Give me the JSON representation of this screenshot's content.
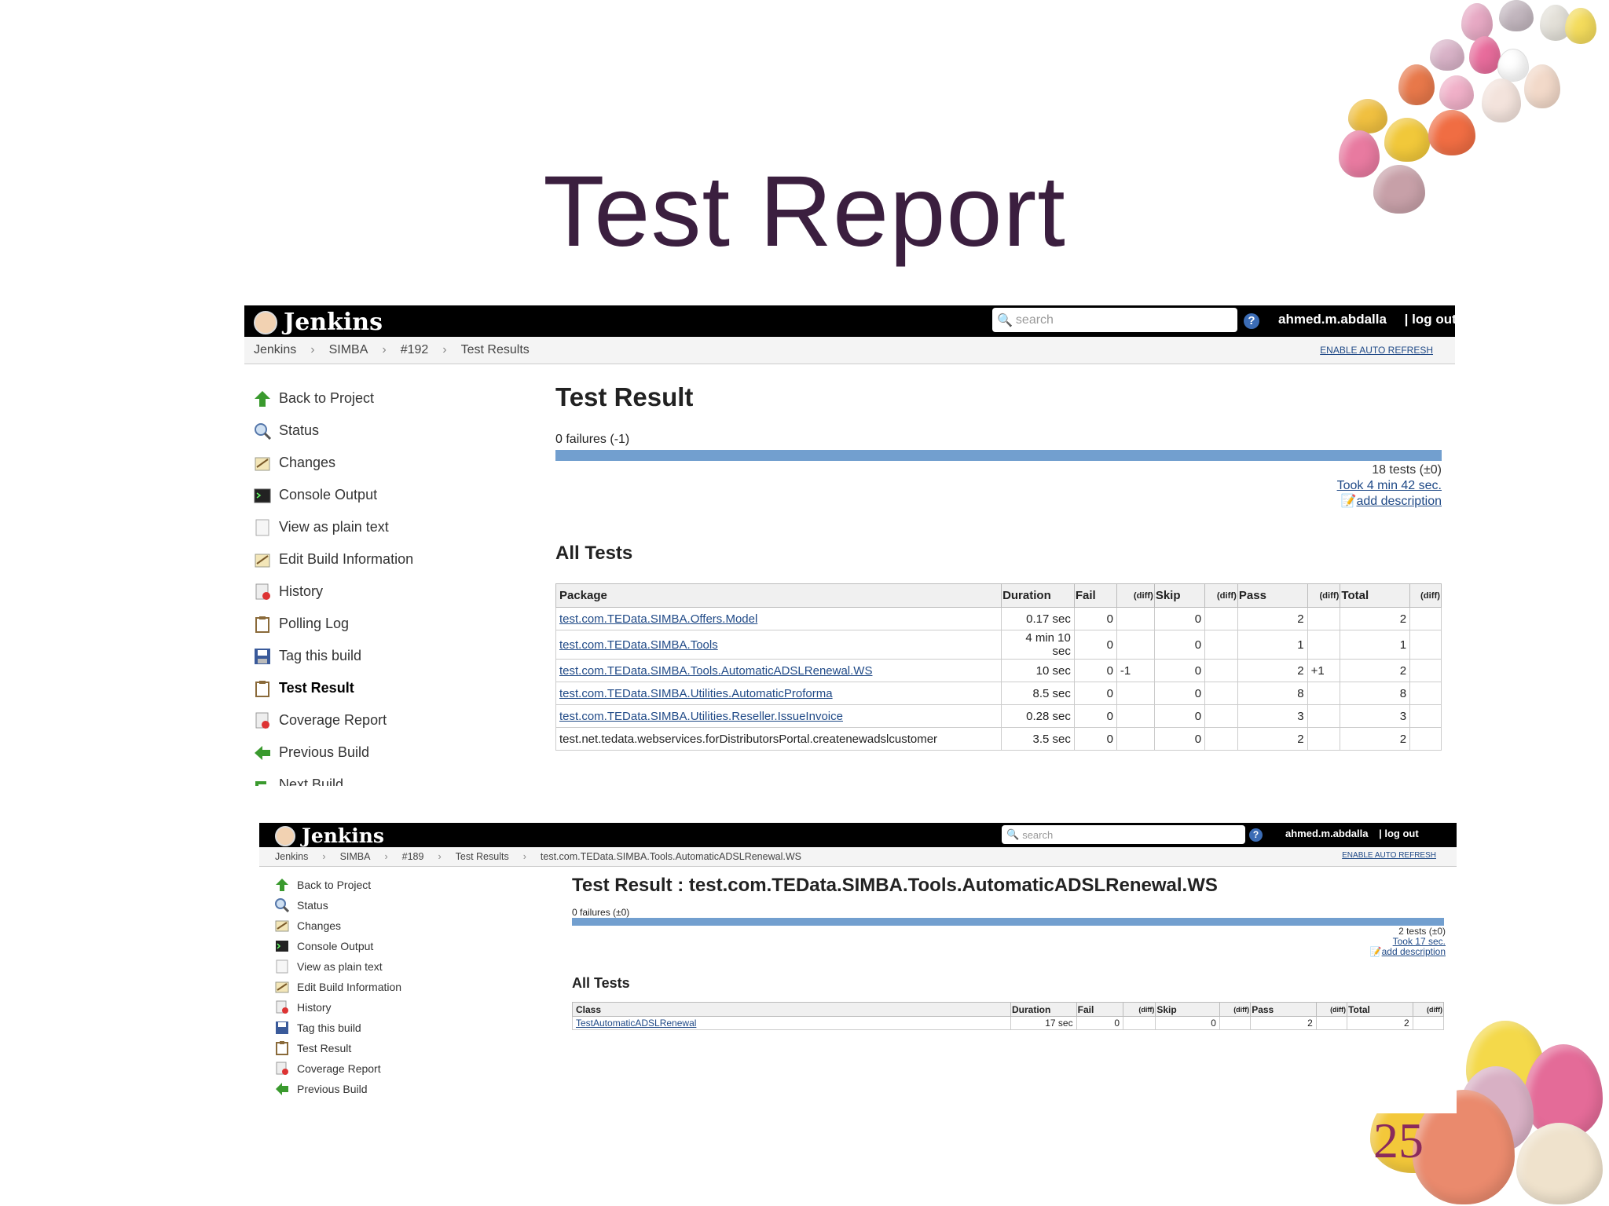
{
  "slide": {
    "title": "Test Report",
    "page_number": "25"
  },
  "panel1": {
    "brand": "Jenkins",
    "search_placeholder": "search",
    "help": "?",
    "user": "ahmed.m.abdalla",
    "logout": "| log out",
    "breadcrumbs": [
      "Jenkins",
      "SIMBA",
      "#192",
      "Test Results"
    ],
    "auto_refresh": "ENABLE AUTO REFRESH",
    "sidebar": [
      {
        "label": "Back to Project",
        "icon": "up-arrow-icon"
      },
      {
        "label": "Status",
        "icon": "magnifier-icon"
      },
      {
        "label": "Changes",
        "icon": "notepad-icon"
      },
      {
        "label": "Console Output",
        "icon": "terminal-icon"
      },
      {
        "label": "View as plain text",
        "icon": "document-icon"
      },
      {
        "label": "Edit Build Information",
        "icon": "notepad-icon"
      },
      {
        "label": "History",
        "icon": "history-icon"
      },
      {
        "label": "Polling Log",
        "icon": "clipboard-icon"
      },
      {
        "label": "Tag this build",
        "icon": "save-icon"
      },
      {
        "label": "Test Result",
        "icon": "clipboard-icon"
      },
      {
        "label": "Coverage Report",
        "icon": "report-icon"
      },
      {
        "label": "Previous Build",
        "icon": "left-arrow-icon"
      },
      {
        "label": "Next Build",
        "icon": "next-arrow-icon"
      }
    ],
    "heading": "Test Result",
    "failures": "0 failures (-1)",
    "progress_pass_fraction": 1.0,
    "tests_summary": "18 tests (±0)",
    "took": "Took 4 min 42 sec.",
    "add_description": "add description",
    "all_tests": "All Tests",
    "columns": [
      "Package",
      "Duration",
      "Fail",
      "(diff)",
      "Skip",
      "(diff)",
      "Pass",
      "(diff)",
      "Total",
      "(diff)"
    ],
    "rows": [
      {
        "name": "test.com.TEData.SIMBA.Offers.Model",
        "link": true,
        "duration": "0.17 sec",
        "fail": "0",
        "fail_diff": "",
        "skip": "0",
        "skip_diff": "",
        "pass": "2",
        "pass_diff": "",
        "total": "2",
        "total_diff": ""
      },
      {
        "name": "test.com.TEData.SIMBA.Tools",
        "link": true,
        "duration": "4 min 10 sec",
        "fail": "0",
        "fail_diff": "",
        "skip": "0",
        "skip_diff": "",
        "pass": "1",
        "pass_diff": "",
        "total": "1",
        "total_diff": ""
      },
      {
        "name": "test.com.TEData.SIMBA.Tools.AutomaticADSLRenewal.WS",
        "link": true,
        "duration": "10 sec",
        "fail": "0",
        "fail_diff": "-1",
        "skip": "0",
        "skip_diff": "",
        "pass": "2",
        "pass_diff": "+1",
        "total": "2",
        "total_diff": ""
      },
      {
        "name": "test.com.TEData.SIMBA.Utilities.AutomaticProforma",
        "link": true,
        "duration": "8.5 sec",
        "fail": "0",
        "fail_diff": "",
        "skip": "0",
        "skip_diff": "",
        "pass": "8",
        "pass_diff": "",
        "total": "8",
        "total_diff": ""
      },
      {
        "name": "test.com.TEData.SIMBA.Utilities.Reseller.IssueInvoice",
        "link": true,
        "duration": "0.28 sec",
        "fail": "0",
        "fail_diff": "",
        "skip": "0",
        "skip_diff": "",
        "pass": "3",
        "pass_diff": "",
        "total": "3",
        "total_diff": ""
      },
      {
        "name": "test.net.tedata.webservices.forDistributorsPortal.createnewadslcustomer",
        "link": false,
        "duration": "3.5 sec",
        "fail": "0",
        "fail_diff": "",
        "skip": "0",
        "skip_diff": "",
        "pass": "2",
        "pass_diff": "",
        "total": "2",
        "total_diff": ""
      }
    ]
  },
  "panel2": {
    "brand": "Jenkins",
    "search_placeholder": "search",
    "help": "?",
    "user": "ahmed.m.abdalla",
    "logout": "| log out",
    "breadcrumbs": [
      "Jenkins",
      "SIMBA",
      "#189",
      "Test Results",
      "test.com.TEData.SIMBA.Tools.AutomaticADSLRenewal.WS"
    ],
    "auto_refresh": "ENABLE AUTO REFRESH",
    "sidebar": [
      {
        "label": "Back to Project",
        "icon": "up-arrow-icon"
      },
      {
        "label": "Status",
        "icon": "magnifier-icon"
      },
      {
        "label": "Changes",
        "icon": "notepad-icon"
      },
      {
        "label": "Console Output",
        "icon": "terminal-icon"
      },
      {
        "label": "View as plain text",
        "icon": "document-icon"
      },
      {
        "label": "Edit Build Information",
        "icon": "notepad-icon"
      },
      {
        "label": "History",
        "icon": "history-icon"
      },
      {
        "label": "Tag this build",
        "icon": "save-icon"
      },
      {
        "label": "Test Result",
        "icon": "clipboard-icon"
      },
      {
        "label": "Coverage Report",
        "icon": "report-icon"
      },
      {
        "label": "Previous Build",
        "icon": "left-arrow-icon"
      }
    ],
    "heading": "Test Result : test.com.TEData.SIMBA.Tools.AutomaticADSLRenewal.WS",
    "failures": "0 failures (±0)",
    "progress_pass_fraction": 1.0,
    "tests_summary": "2 tests (±0)",
    "took": "Took 17 sec.",
    "add_description": "add description",
    "all_tests": "All Tests",
    "columns": [
      "Class",
      "Duration",
      "Fail",
      "(diff)",
      "Skip",
      "(diff)",
      "Pass",
      "(diff)",
      "Total",
      "(diff)"
    ],
    "rows": [
      {
        "name": "TestAutomaticADSLRenewal",
        "link": true,
        "duration": "17 sec",
        "fail": "0",
        "fail_diff": "",
        "skip": "0",
        "skip_diff": "",
        "pass": "2",
        "pass_diff": "",
        "total": "2",
        "total_diff": ""
      }
    ]
  }
}
